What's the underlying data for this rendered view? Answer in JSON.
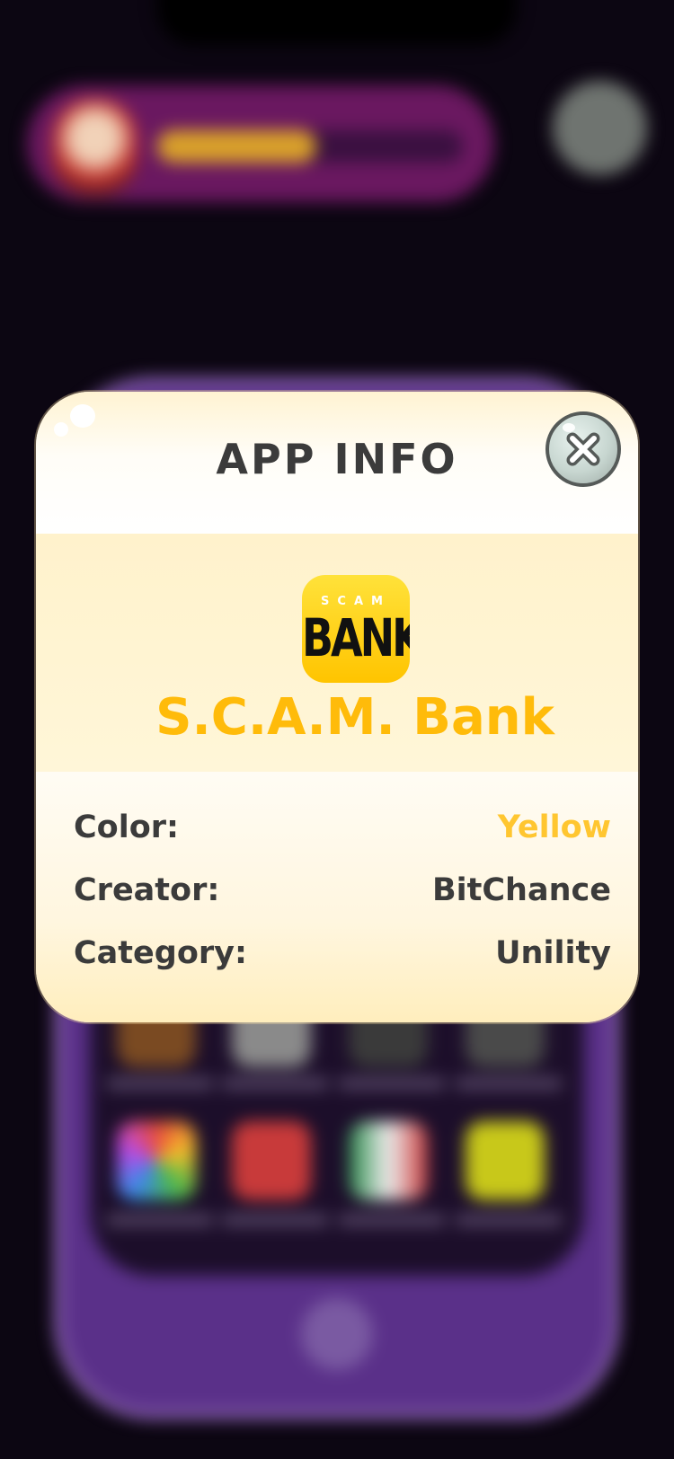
{
  "background": {
    "level_progress": 0.52
  },
  "dialog": {
    "title": "APP INFO",
    "close_icon": "close-x-icon"
  },
  "app": {
    "icon_top_text": "SCAM",
    "icon_main_text": "BANK",
    "icon_color": "#ffd000",
    "name": "S.C.A.M. Bank",
    "name_color": "#ffbb0a"
  },
  "info": {
    "rows": [
      {
        "label": "Color:",
        "value": "Yellow",
        "value_color": "#ffc630"
      },
      {
        "label": "Creator:",
        "value": "BitChance",
        "value_color": "#3b3b3b"
      },
      {
        "label": "Category:",
        "value": "Unility",
        "value_color": "#3b3b3b"
      }
    ]
  }
}
